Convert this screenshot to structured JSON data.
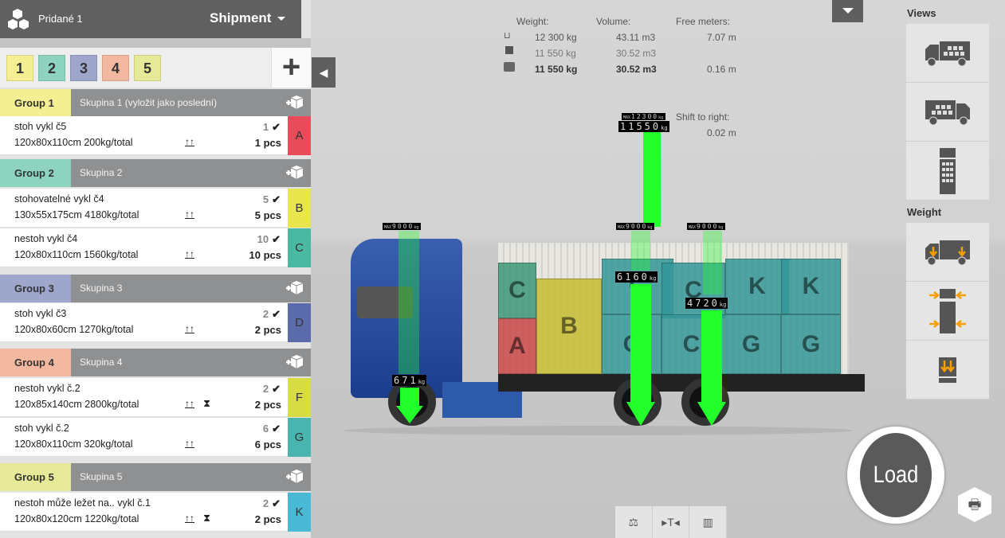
{
  "header": {
    "project": "Pridané 1",
    "shipment": "Shipment"
  },
  "group_tabs": [
    {
      "label": "1",
      "color": "#f5ef94"
    },
    {
      "label": "2",
      "color": "#8dd3bf"
    },
    {
      "label": "3",
      "color": "#9ea6cb"
    },
    {
      "label": "4",
      "color": "#f2b9a0"
    },
    {
      "label": "5",
      "color": "#e6ea98"
    }
  ],
  "add_label": "+",
  "groups": [
    {
      "label": "Group 1",
      "name": "Skupina 1 (vyložit jako poslední)",
      "color": "#f5ef94",
      "items": [
        {
          "name": "stoh vykl č5",
          "dims": "120x80x110cm 200kg/total",
          "count": "1",
          "pcs": "1 pcs",
          "letter": "A",
          "color": "#e94b5a",
          "nonstack": false
        }
      ]
    },
    {
      "label": "Group 2",
      "name": "Skupina 2",
      "color": "#8dd3bf",
      "items": [
        {
          "name": "stohovatelné vykl č4",
          "dims": "130x55x175cm 4180kg/total",
          "count": "5",
          "pcs": "5 pcs",
          "letter": "B",
          "color": "#e8e64c",
          "nonstack": false
        },
        {
          "name": "nestoh vykl č4",
          "dims": "120x80x110cm 1560kg/total",
          "count": "10",
          "pcs": "10 pcs",
          "letter": "C",
          "color": "#4bb8a1",
          "nonstack": false
        }
      ]
    },
    {
      "label": "Group 3",
      "name": "Skupina 3",
      "color": "#9ea6cb",
      "items": [
        {
          "name": "stoh vykl č3",
          "dims": "120x80x60cm 1270kg/total",
          "count": "2",
          "pcs": "2 pcs",
          "letter": "D",
          "color": "#5b6aaa",
          "nonstack": false
        }
      ]
    },
    {
      "label": "Group 4",
      "name": "Skupina 4",
      "color": "#f2b9a0",
      "items": [
        {
          "name": "nestoh vykl č.2",
          "dims": "120x85x140cm 2800kg/total",
          "count": "2",
          "pcs": "2 pcs",
          "letter": "F",
          "color": "#d8dc43",
          "nonstack": true
        },
        {
          "name": "stoh vykl č.2",
          "dims": "120x80x110cm 320kg/total",
          "count": "6",
          "pcs": "6 pcs",
          "letter": "G",
          "color": "#4ab5ae",
          "nonstack": false
        }
      ]
    },
    {
      "label": "Group 5",
      "name": "Skupina 5",
      "color": "#e6ea98",
      "items": [
        {
          "name": "nestoh může ležet na.. vykl č.1",
          "dims": "120x80x120cm 1220kg/total",
          "count": "2",
          "pcs": "2 pcs",
          "letter": "K",
          "color": "#4ab9d6",
          "nonstack": true
        }
      ]
    }
  ],
  "stats": {
    "headers": [
      "Weight:",
      "Volume:",
      "Free meters:"
    ],
    "rows": [
      {
        "icon": "trailer-icon",
        "weight": "12 300 kg",
        "volume": "43.11 m3",
        "free": "7.07 m"
      },
      {
        "icon": "cargo-icon",
        "weight": "11 550 kg",
        "volume": "30.52 m3",
        "free": ""
      },
      {
        "icon": "loaded-trailer-icon",
        "weight": "11 550 kg",
        "volume": "30.52 m3",
        "free": "0.16 m"
      }
    ],
    "shift_label": "Shift to right:",
    "shift_value": "0.02 m"
  },
  "axles": [
    {
      "max": "9000",
      "load": "671"
    },
    {
      "max": "9000",
      "load": "6160"
    },
    {
      "max": "9000",
      "load": "4720"
    }
  ],
  "total_indicator": {
    "max": "12300",
    "load": "11550"
  },
  "units": {
    "max": "MAX",
    "kg": "kg"
  },
  "cargo_letters": [
    "C",
    "A",
    "B",
    "C",
    "C",
    "K",
    "K",
    "C",
    "C",
    "G",
    "G"
  ],
  "right": {
    "views_label": "Views",
    "weight_label": "Weight"
  },
  "load_label": "Load",
  "accent": "#f5a000",
  "bar_color": "#22ff2a"
}
